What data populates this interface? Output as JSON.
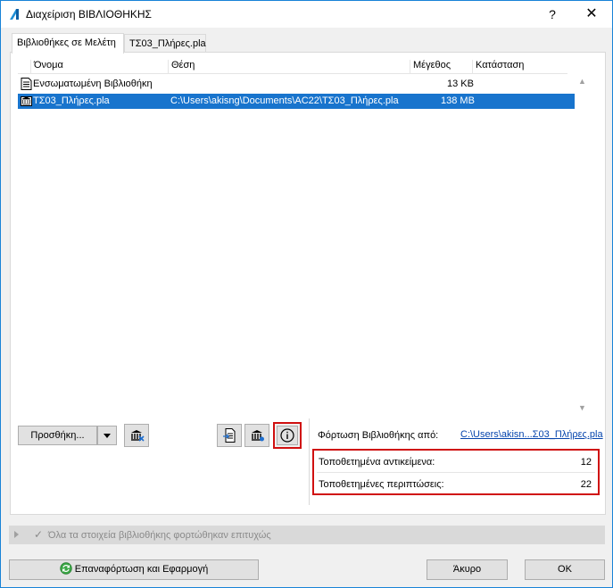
{
  "window": {
    "title": "Διαχείριση ΒΙΒΛΙΟΘΗΚΗΣ",
    "help_glyph": "?",
    "close_glyph": "✕"
  },
  "tabs": [
    {
      "label": "Βιβλιοθήκες σε Μελέτη",
      "active": true
    },
    {
      "label": "ΤΣ03_Πλήρες.pla",
      "active": false
    }
  ],
  "list": {
    "columns": [
      "Όνομα",
      "Θέση",
      "Μέγεθος",
      "Κατάσταση"
    ],
    "rows": [
      {
        "name": "Ενσωματωμένη Βιβλιοθήκη",
        "location": "",
        "size": "13 KB",
        "status": "",
        "icon": "embedded-library-icon",
        "selected": false
      },
      {
        "name": "ΤΣ03_Πλήρες.pla",
        "location": "C:\\Users\\akisng\\Documents\\AC22\\ΤΣ03_Πλήρες.pla",
        "size": "138 MB",
        "status": "",
        "icon": "library-container-icon",
        "selected": true
      }
    ]
  },
  "buttons": {
    "add": "Προσθήκη...",
    "reload_apply": "Επαναφόρτωση και Εφαρμογή",
    "cancel": "Άκυρο",
    "ok": "ΟΚ"
  },
  "details": {
    "load_from_label": "Φόρτωση Βιβλιοθήκης από:",
    "load_from_path": "C:\\Users\\akisn...Σ03_Πλήρες.pla",
    "placed_objects_label": "Τοποθετημένα αντικείμενα:",
    "placed_objects_value": "12",
    "placed_instances_label": "Τοποθετημένες περιπτώσεις:",
    "placed_instances_value": "22"
  },
  "status": {
    "message": "Όλα τα στοιχεία βιβλιοθήκης φορτώθηκαν επιτυχώς"
  },
  "colors": {
    "selection": "#1874cd",
    "highlight_border": "#d01010",
    "link": "#0645ad",
    "window_border": "#1883d7"
  }
}
